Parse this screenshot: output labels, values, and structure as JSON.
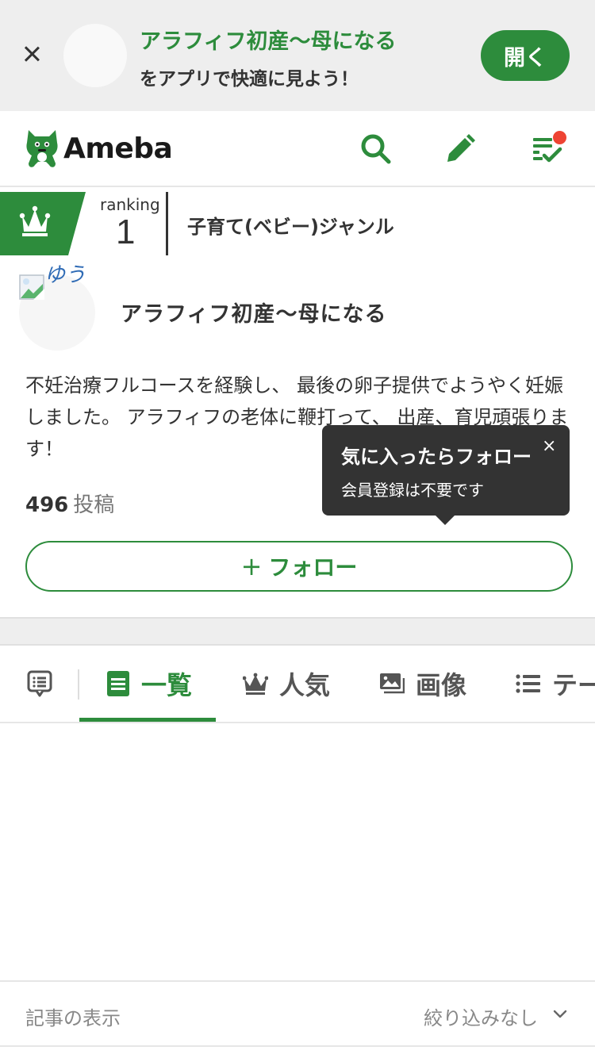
{
  "app_banner": {
    "title": "アラフィフ初産～母になる",
    "subtitle": "をアプリで快適に見よう！",
    "open_label": "開く"
  },
  "header": {
    "logo_text": "Ameba",
    "icons": [
      "search-icon",
      "pencil-icon",
      "checklist-icon"
    ],
    "notification": true
  },
  "ranking": {
    "label": "ranking",
    "number": "1",
    "genre": "子育て(ベビー)ジャンル"
  },
  "profile": {
    "avatar_alt": "ゆう",
    "blog_title": "アラフィフ初産～母になる",
    "description": "不妊治療フルコースを経験し、 最後の卵子提供でようやく妊娠しました。 アラフィフの老体に鞭打って、 出産、育児頑張ります！",
    "post_count": "496",
    "post_label": "投稿"
  },
  "tooltip": {
    "title": "気に入ったらフォロー",
    "subtitle": "会員登録は不要です",
    "close": "×"
  },
  "follow_button": {
    "plus": "+",
    "label": "フォロー"
  },
  "tabs": [
    {
      "label": "",
      "icon": "message-icon"
    },
    {
      "label": "一覧",
      "icon": "list-doc-icon",
      "active": true
    },
    {
      "label": "人気",
      "icon": "crown-icon"
    },
    {
      "label": "画像",
      "icon": "image-icon"
    },
    {
      "label": "テーマ",
      "icon": "bullet-list-icon"
    }
  ],
  "filter": {
    "label": "記事の表示",
    "value": "絞り込みなし"
  },
  "colors": {
    "brand_green": "#2d8c3c",
    "notification_red": "#ee4433",
    "tooltip_bg": "#333333"
  }
}
